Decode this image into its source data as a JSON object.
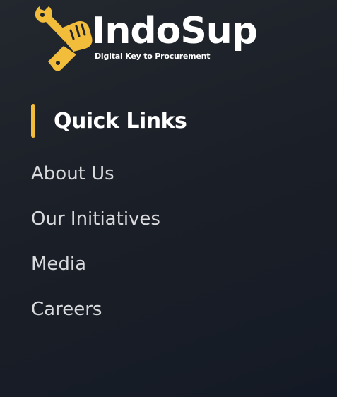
{
  "logo": {
    "title": "IndoSup",
    "tagline": "Digital Key to Procurement",
    "icon": "hand-wrench-icon",
    "accent_color": "#f2bd3b"
  },
  "quick_links": {
    "title": "Quick Links",
    "accent_color": "#f2bd3b",
    "items": [
      {
        "label": "About Us"
      },
      {
        "label": "Our Initiatives"
      },
      {
        "label": "Media"
      },
      {
        "label": "Careers"
      }
    ]
  }
}
